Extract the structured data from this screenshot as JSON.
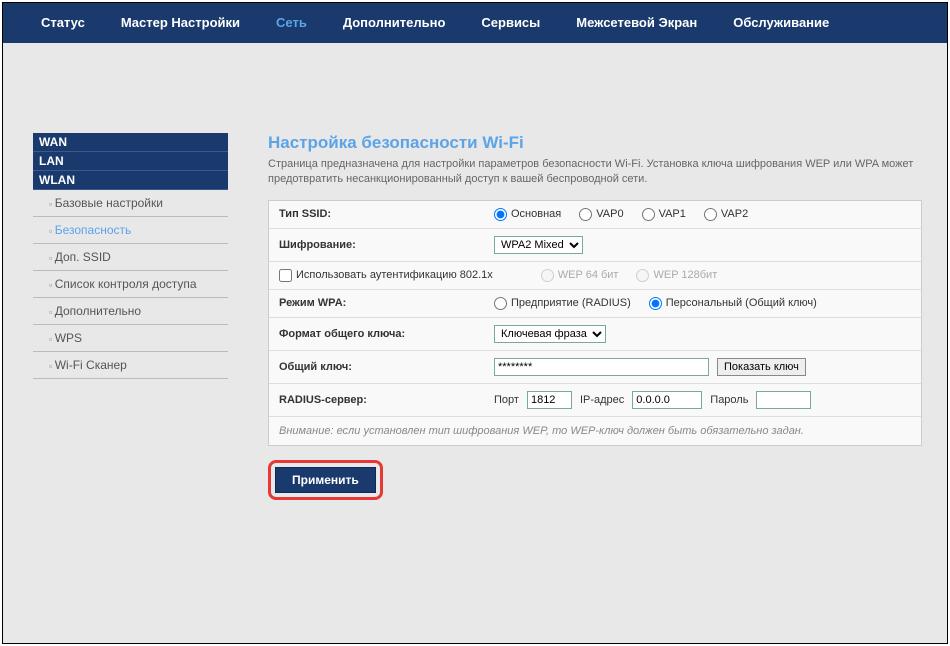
{
  "nav": {
    "items": [
      "Статус",
      "Мастер Настройки",
      "Сеть",
      "Дополнительно",
      "Сервисы",
      "Межсетевой Экран",
      "Обслуживание"
    ],
    "active": 2
  },
  "sidebar": {
    "cats": [
      "WAN",
      "LAN",
      "WLAN"
    ],
    "subs": [
      "Базовые настройки",
      "Безопасность",
      "Доп. SSID",
      "Список контроля доступа",
      "Дополнительно",
      "WPS",
      "Wi-Fi Сканер"
    ],
    "sub_active": 1
  },
  "page": {
    "title": "Настройка безопасности Wi-Fi",
    "desc": "Страница предназначена для настройки параметров безопасности Wi-Fi. Установка ключа шифрования WEP или WPA может предотвратить несанкционированный доступ к вашей беспроводной сети."
  },
  "form": {
    "ssid_label": "Тип SSID:",
    "ssid_opts": [
      "Основная",
      "VAP0",
      "VAP1",
      "VAP2"
    ],
    "enc_label": "Шифрование:",
    "enc_value": "WPA2 Mixed",
    "auth8021x_label": "Использовать аутентификацию 802.1x",
    "wep_opts": [
      "WEP 64 бит",
      "WEP 128бит"
    ],
    "wpa_mode_label": "Режим WPA:",
    "wpa_mode_opts": [
      "Предприятие (RADIUS)",
      "Персональный (Общий ключ)"
    ],
    "key_fmt_label": "Формат общего ключа:",
    "key_fmt_value": "Ключевая фраза",
    "psk_label": "Общий ключ:",
    "psk_value": "********",
    "show_key": "Показать ключ",
    "radius_label": "RADIUS-сервер:",
    "radius_port_lbl": "Порт",
    "radius_port": "1812",
    "radius_ip_lbl": "IP-адрес",
    "radius_ip": "0.0.0.0",
    "radius_pw_lbl": "Пароль",
    "note": "Внимание: если установлен тип шифрования WEP, то WEP-ключ должен быть обязательно задан.",
    "apply": "Применить"
  }
}
